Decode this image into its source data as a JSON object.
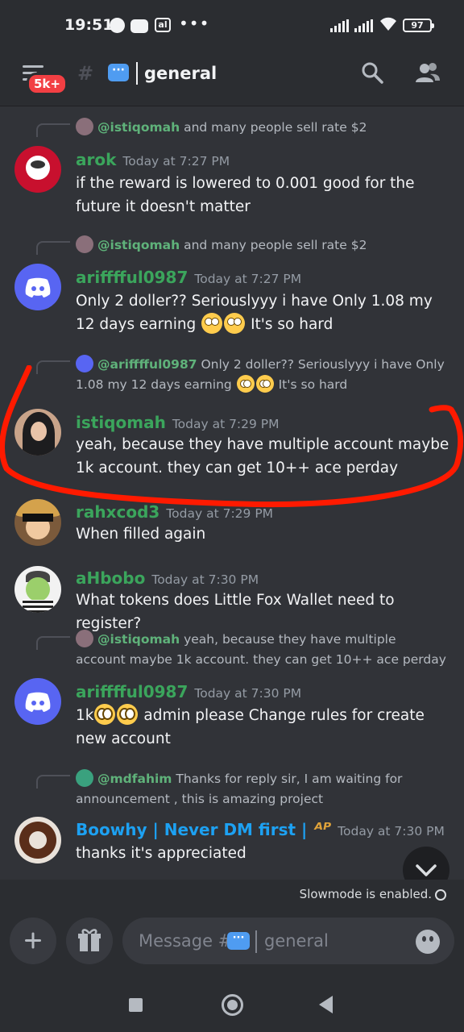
{
  "status_bar": {
    "time": "19:51",
    "app_icon_label": "al",
    "battery": "97"
  },
  "header": {
    "badge": "5k+",
    "channel_emoji": "💬",
    "channel": "general"
  },
  "messages": [
    {
      "reply": {
        "mention": "@istiqomah",
        "text": " and many people sell rate $2"
      },
      "author": "arok",
      "author_color": "#3ba55c",
      "time": "Today at 7:27 PM",
      "text": "if the reward is lowered to 0.001 good for the future it doesn't matter"
    },
    {
      "reply": {
        "mention": "@istiqomah",
        "text": " and many people sell rate $2"
      },
      "author": "arifffful0987",
      "author_color": "#3ba55c",
      "time": "Today at 7:27 PM",
      "text_a": "Only 2 doller??  Seriouslyyy i have Only 1.08 my 12 days earning ",
      "text_b": " It's so hard"
    },
    {
      "reply": {
        "mention": "@arifffful0987",
        "text_a": " Only 2 doller??  Seriouslyyy i have Only 1.08 my 12 days earning ",
        "text_b": " It's so hard"
      },
      "author": "istiqomah",
      "author_color": "#3ba55c",
      "time": "Today at 7:29 PM",
      "text": "yeah, because they have multiple account maybe 1k account. they can get 10++ ace perday"
    },
    {
      "author": "rahxcod3",
      "author_color": "#3ba55c",
      "time": "Today at 7:29 PM",
      "text": "When filled again"
    },
    {
      "author": "aHbobo",
      "author_color": "#3ba55c",
      "time": "Today at 7:30 PM",
      "text": "What tokens does Little Fox Wallet need to register?"
    },
    {
      "reply": {
        "mention": "@istiqomah",
        "text": " yeah, because they have multiple account maybe 1k account. they can get 10++ ace perday"
      },
      "author": "arifffful0987",
      "author_color": "#3ba55c",
      "time": "Today at 7:30 PM",
      "text_a": "1k",
      "text_b": " admin please Change rules for create new account"
    },
    {
      "reply": {
        "mention": "@mdfahim",
        "text": " Thanks for reply sir, I am waiting for announcement , this is amazing project"
      },
      "author": "Boowhy | Never DM first | ",
      "author_color": "#1da1f2",
      "time": "Today at 7:30 PM",
      "text": "thanks it's appreciated"
    }
  ],
  "slowmode": "Slowmode is enabled.",
  "composer": {
    "placeholder": "Message #",
    "emoji": "💬",
    "channel": "general"
  },
  "colors": {
    "background": "#313338",
    "header": "#2b2d31",
    "mention": "#5fb27a",
    "annotation": "#ff1a00"
  }
}
